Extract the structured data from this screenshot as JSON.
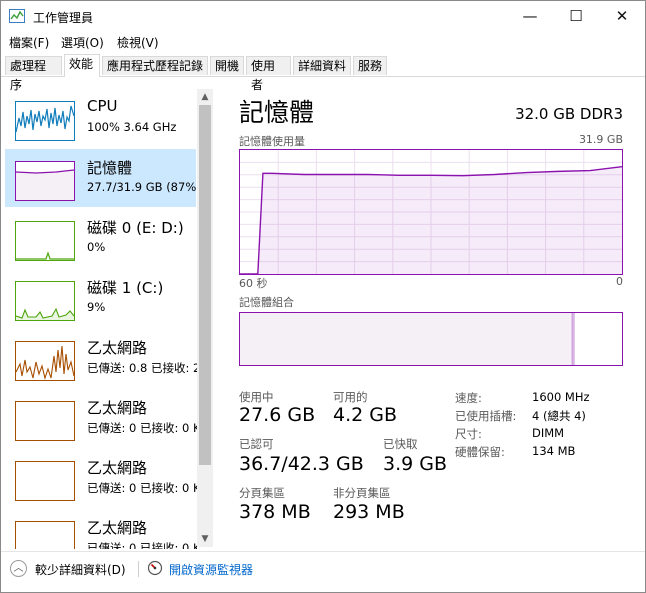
{
  "window": {
    "title": "工作管理員",
    "minimize": "—",
    "maximize": "☐",
    "close": "✕"
  },
  "menu": [
    "檔案(F)",
    "選項(O)",
    "檢視(V)"
  ],
  "tabs": [
    "處理程序",
    "效能",
    "應用程式歷程記錄",
    "開機",
    "使用者",
    "詳細資料",
    "服務"
  ],
  "active_tab": "效能",
  "sidebar": {
    "items": [
      {
        "name": "CPU",
        "sub": "100%  3.64 GHz",
        "color": "#117dbb"
      },
      {
        "name": "記憶體",
        "sub": "27.7/31.9 GB (87%)",
        "color": "#8b12ae"
      },
      {
        "name": "磁碟 0 (E: D:)",
        "sub": "0%",
        "color": "#4da60c"
      },
      {
        "name": "磁碟 1 (C:)",
        "sub": "9%",
        "color": "#4da60c"
      },
      {
        "name": "乙太網路",
        "sub": "已傳送: 0.8 已接收: 2",
        "color": "#a74f01"
      },
      {
        "name": "乙太網路",
        "sub": "已傳送: 0 已接收: 0 K",
        "color": "#a74f01"
      },
      {
        "name": "乙太網路",
        "sub": "已傳送: 0 已接收: 0 K",
        "color": "#a74f01"
      },
      {
        "name": "乙太網路",
        "sub": "已傳送: 0 已接收: 0 K",
        "color": "#a74f01"
      }
    ]
  },
  "main": {
    "title": "記憶體",
    "spec": "32.0 GB DDR3",
    "usage_label": "記憶體使用量",
    "usage_max": "31.9 GB",
    "time_left": "60 秒",
    "time_right": "0",
    "composition_label": "記憶體組合",
    "stats": [
      {
        "label": "使用中",
        "value": "27.6 GB"
      },
      {
        "label": "可用的",
        "value": "4.2 GB"
      },
      {
        "label": "已認可",
        "value": "36.7/42.3 GB"
      },
      {
        "label": "已快取",
        "value": "3.9 GB"
      },
      {
        "label": "分頁集區",
        "value": "378 MB"
      },
      {
        "label": "非分頁集區",
        "value": "293 MB"
      }
    ],
    "props": [
      {
        "label": "速度:",
        "value": "1600 MHz"
      },
      {
        "label": "已使用插槽:",
        "value": "4 (總共 4)"
      },
      {
        "label": "尺寸:",
        "value": "DIMM"
      },
      {
        "label": "硬體保留:",
        "value": "134 MB"
      }
    ]
  },
  "chart_data": {
    "type": "area",
    "ylim": [
      0,
      31.9
    ],
    "xlim": [
      60,
      0
    ],
    "x": [
      60,
      57.2,
      56.4,
      55,
      50,
      45,
      40,
      35,
      30,
      25,
      20,
      15,
      10,
      5,
      0
    ],
    "values": [
      0,
      0,
      25.9,
      25.9,
      25.6,
      25.6,
      25.6,
      25.4,
      25.4,
      25.3,
      25.6,
      26.1,
      26.4,
      26.6,
      27.6
    ],
    "composition": {
      "in_use_fraction": 0.87,
      "modified_fraction": 0.005,
      "standby_fraction": 0.12
    }
  },
  "footer": {
    "fewer_details": "較少詳細資料(D)",
    "resource_monitor": "開啟資源監視器"
  }
}
